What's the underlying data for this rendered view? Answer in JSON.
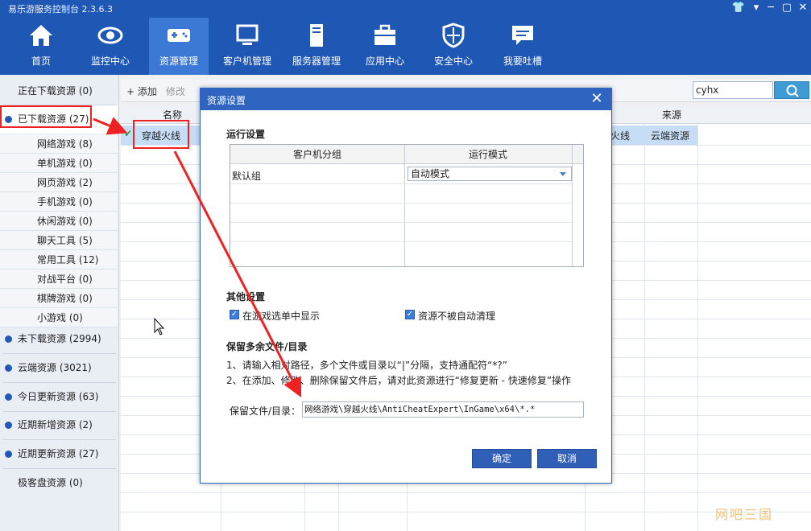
{
  "app": {
    "title": "易乐游服务控制台 2.3.6.3"
  },
  "nav": [
    {
      "label": "首页",
      "icon": "home-icon"
    },
    {
      "label": "监控中心",
      "icon": "eye-icon"
    },
    {
      "label": "资源管理",
      "icon": "gamepad-icon"
    },
    {
      "label": "客户机管理",
      "icon": "monitor-icon"
    },
    {
      "label": "服务器管理",
      "icon": "server-icon"
    },
    {
      "label": "应用中心",
      "icon": "toolbox-icon"
    },
    {
      "label": "安全中心",
      "icon": "shield-icon"
    },
    {
      "label": "我要吐槽",
      "icon": "chat-icon"
    }
  ],
  "sidebar": {
    "downloading": "正在下载资源 (0)",
    "downloaded": "已下载资源 (27)",
    "sub": [
      "网络游戏 (8)",
      "单机游戏 (0)",
      "网页游戏 (2)",
      "手机游戏 (0)",
      "休闲游戏 (0)",
      "聊天工具 (5)",
      "常用工具 (12)",
      "对战平台 (0)",
      "棋牌游戏 (0)",
      "小游戏 (0)"
    ],
    "groups": [
      "未下载资源 (2994)",
      "云端资源 (3021)",
      "今日更新资源 (63)",
      "近期新增资源 (2)",
      "近期更新资源 (27)",
      "极客盘资源 (0)"
    ]
  },
  "toolbar": {
    "add": "+ 添加",
    "edit": "修改"
  },
  "search": {
    "value": "cyhx"
  },
  "grid": {
    "col_name": "名称",
    "col_source": "来源",
    "row": {
      "name": "穿越火线",
      "mid": "火线",
      "source": "云端资源"
    }
  },
  "dialog": {
    "title": "资源设置",
    "run_settings": "运行设置",
    "col_group": "客户机分组",
    "col_mode": "运行模式",
    "row_group": "默认组",
    "row_mode": "自动模式",
    "other_settings": "其他设置",
    "cb_show": "在游戏选单中显示",
    "cb_noclean": "资源不被自动清理",
    "keep_section": "保留多余文件/目录",
    "note1": "1、请输入相对路径，多个文件或目录以“|”分隔，支持通配符“*?”",
    "note2": "2、在添加、修改、删除保留文件后，请对此资源进行“修复更新 - 快速修复”操作",
    "keep_label": "保留文件/目录：",
    "keep_value": "网络游戏\\穿越火线\\AntiCheatExpert\\InGame\\x64\\*.*",
    "ok": "确定",
    "cancel": "取消"
  },
  "watermark": "网吧三国",
  "colors": {
    "topbar": "#1f57b5",
    "active_nav": "#3c79d6",
    "dialog_title": "#2f64c0",
    "annotation": "#e22222"
  }
}
